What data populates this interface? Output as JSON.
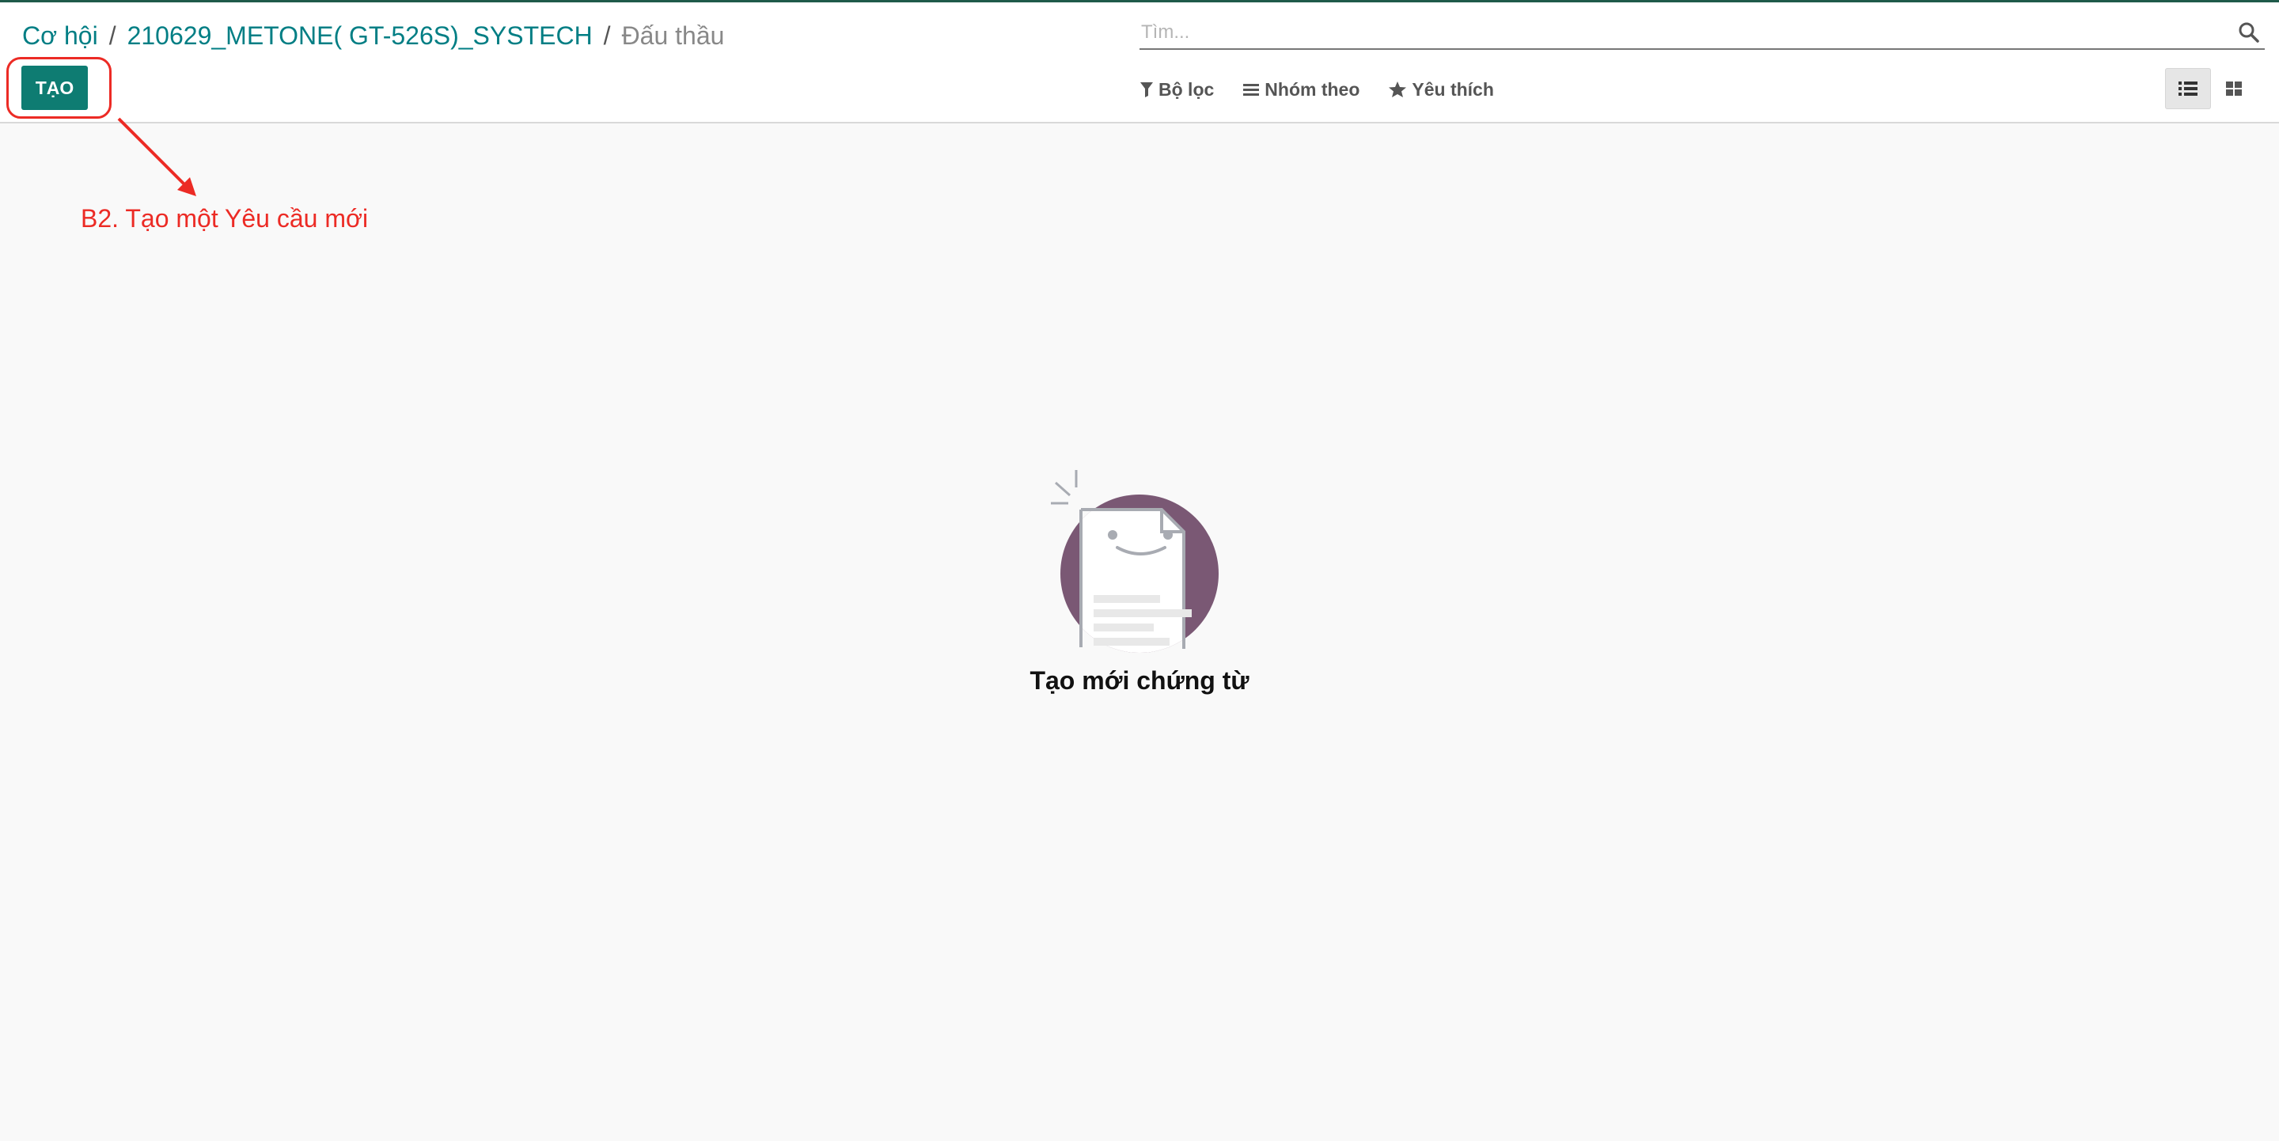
{
  "breadcrumb": {
    "items": [
      "Cơ hội",
      "210629_METONE( GT-526S)_SYSTECH"
    ],
    "separator": "/",
    "current": "Đấu thầu"
  },
  "toolbar": {
    "create_label": "TẠO"
  },
  "search": {
    "placeholder": "Tìm...",
    "icon": "search-icon"
  },
  "filters": {
    "filter_label": "Bộ lọc",
    "groupby_label": "Nhóm theo",
    "favorites_label": "Yêu thích"
  },
  "view_switcher": {
    "active": "list",
    "views": [
      "list-view-icon",
      "kanban-view-icon"
    ]
  },
  "annotation": {
    "text": "B2. Tạo một Yêu cầu mới",
    "color": "#ec2b25"
  },
  "empty_state": {
    "title": "Tạo mới chứng từ"
  },
  "colors": {
    "primary": "#0e7c72",
    "link": "#017e84",
    "illustration_circle": "#7a5874"
  }
}
